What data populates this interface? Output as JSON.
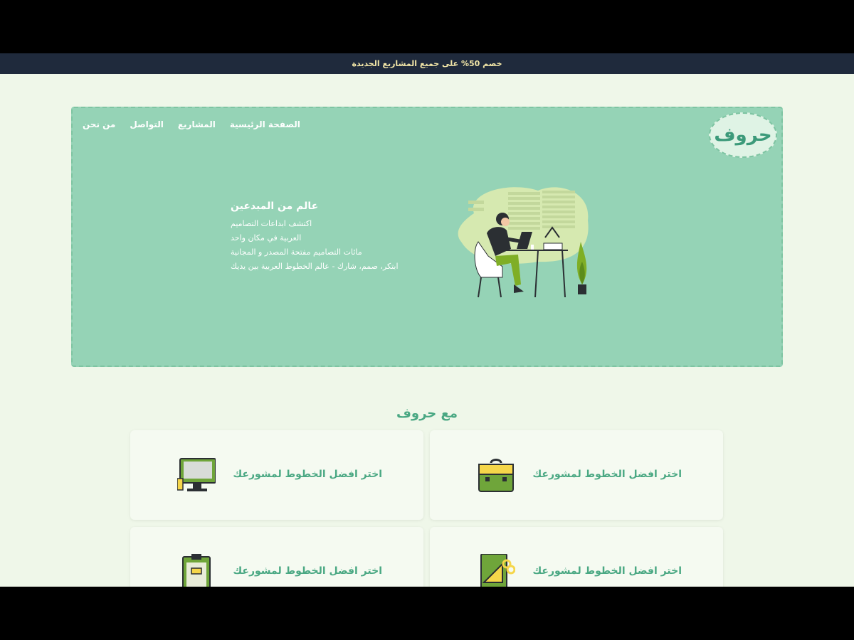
{
  "promo": {
    "text": "خصم 50% على جميع المشاريع الجديدة"
  },
  "logo": {
    "text": "حروف"
  },
  "nav": {
    "home": "الصفحة الرئيسية",
    "projects": "المشاريع",
    "contact": "التواصل",
    "about": "من نحن"
  },
  "hero": {
    "title": "عالم من المبدعين",
    "lines": [
      "اكتشف ابداعات التصاميم",
      "العربية في مكان واحد",
      "مائات التصاميم مفتحة المصدر و المجانية",
      "ابتكر، صمم، شارك - عالم الخطوط العربية بين يديك"
    ]
  },
  "section": {
    "title": "مع حروف"
  },
  "cards": [
    {
      "label": "اختر افضل الخطوط لمشورعك",
      "icon": "briefcase-icon"
    },
    {
      "label": "اختر افضل الخطوط لمشورعك",
      "icon": "monitor-icon"
    },
    {
      "label": "اختر افضل الخطوط لمشورعك",
      "icon": "drafting-tools-icon"
    },
    {
      "label": "اختر افضل الخطوط لمشورعك",
      "icon": "clipboard-icon"
    }
  ],
  "colors": {
    "background": "#eff7e9",
    "promo_bar": "#1f2a3c",
    "hero": "#95d3b6",
    "accent": "#4aa883"
  }
}
